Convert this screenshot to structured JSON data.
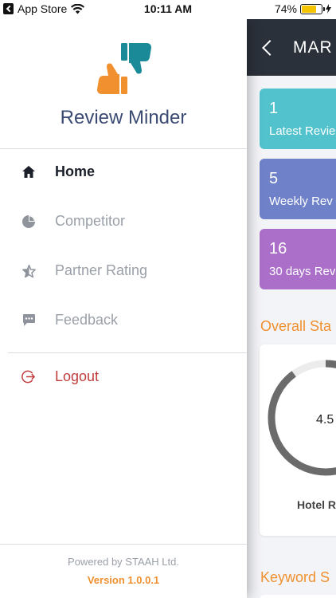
{
  "status_bar": {
    "carrier": "App Store",
    "time": "10:11 AM",
    "battery": "74%",
    "battery_level": 0.74
  },
  "drawer": {
    "brand": "Review Minder",
    "menu": {
      "home": "Home",
      "competitor": "Competitor",
      "partner_rating": "Partner Rating",
      "feedback": "Feedback",
      "logout": "Logout"
    },
    "footer": {
      "powered_by": "Powered by STAAH Ltd.",
      "version": "Version 1.0.0.1"
    }
  },
  "main": {
    "title": "MAR",
    "cards": [
      {
        "value": "1",
        "label": "Latest Revie"
      },
      {
        "value": "5",
        "label": "Weekly Rev"
      },
      {
        "value": "16",
        "label": "30 days Rev"
      }
    ],
    "overall_section": "Overall Sta",
    "gauge": {
      "score": "4.5",
      "label": "Hotel R",
      "fraction": 0.9
    },
    "keyword_section": "Keyword S"
  },
  "colors": {
    "drawer_accent": "#3b4a72",
    "orange": "#f0902f",
    "logout_red": "#c13c3c",
    "card_teal": "#52c2cd",
    "card_blue": "#6f81c8",
    "card_purple": "#ab6fc9",
    "topbar": "#2b313b"
  }
}
